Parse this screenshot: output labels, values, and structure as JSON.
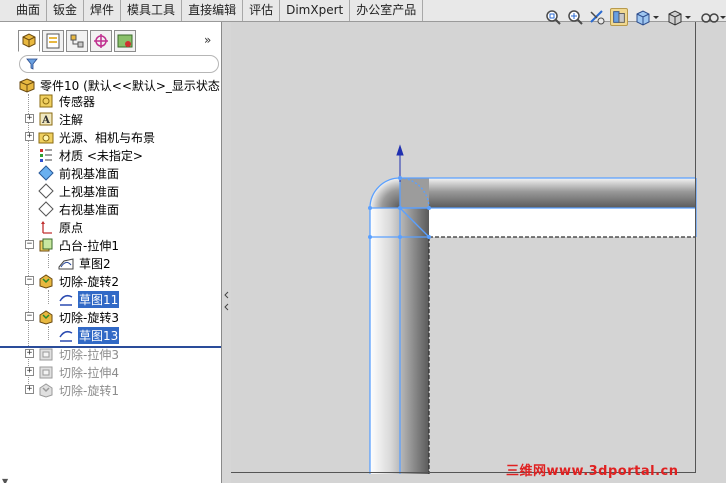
{
  "tabs": [
    {
      "label": "曲面"
    },
    {
      "label": "钣金"
    },
    {
      "label": "焊件"
    },
    {
      "label": "模具工具"
    },
    {
      "label": "直接编辑"
    },
    {
      "label": "评估"
    },
    {
      "label": "DimXpert"
    },
    {
      "label": "办公室产品"
    }
  ],
  "panel": {
    "tab_icons": [
      "feature-manager-icon",
      "property-manager-icon",
      "configuration-manager-icon",
      "dimxpert-manager-icon",
      "display-manager-icon"
    ],
    "expand_label": "»"
  },
  "tree": {
    "root": "零件10  (默认<<默认>_显示状态",
    "items": [
      {
        "label": "传感器",
        "icon": "sensor-icon"
      },
      {
        "label": "注解",
        "icon": "annotation-icon"
      },
      {
        "label": "光源、相机与布景",
        "icon": "lights-camera-icon"
      },
      {
        "label": "材质 <未指定>",
        "icon": "material-icon"
      },
      {
        "label": "前视基准面",
        "icon": "plane-icon"
      },
      {
        "label": "上视基准面",
        "icon": "plane-icon"
      },
      {
        "label": "右视基准面",
        "icon": "plane-icon"
      },
      {
        "label": "原点",
        "icon": "origin-icon"
      },
      {
        "label": "凸台-拉伸1",
        "icon": "boss-extrude-icon"
      },
      {
        "label": "草图2",
        "icon": "sketch-icon"
      },
      {
        "label": "切除-旋转2",
        "icon": "cut-revolve-icon"
      },
      {
        "label": "草图11",
        "icon": "sketch-icon"
      },
      {
        "label": "切除-旋转3",
        "icon": "cut-revolve-icon"
      },
      {
        "label": "草图13",
        "icon": "sketch-icon"
      },
      {
        "label": "切除-拉伸3",
        "icon": "cut-extrude-icon"
      },
      {
        "label": "切除-拉伸4",
        "icon": "cut-extrude-icon"
      },
      {
        "label": "切除-旋转1",
        "icon": "cut-revolve-icon"
      }
    ]
  },
  "toolbar": {
    "icons": [
      "zoom-to-fit-icon",
      "zoom-to-area-icon",
      "previous-view-icon",
      "section-view-icon",
      "view-orientation-icon",
      "display-style-icon",
      "hide-show-items-icon"
    ]
  },
  "watermark": "三维网www.3dportal.cn",
  "colors": {
    "selection": "#3169c6",
    "sketch_line": "#5aa0ff",
    "watermark": "#e02020"
  }
}
